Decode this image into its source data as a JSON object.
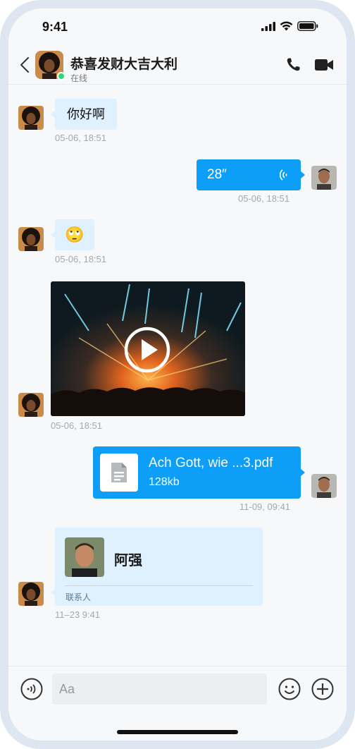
{
  "status_bar": {
    "time": "9:41"
  },
  "header": {
    "title": "恭喜发财大吉大利",
    "status": "在线"
  },
  "messages": [
    {
      "type": "text",
      "direction": "in",
      "text": "你好啊",
      "time": "05-06, 18:51"
    },
    {
      "type": "voice",
      "direction": "out",
      "duration": "28″",
      "time": "05-06, 18:51"
    },
    {
      "type": "emoji",
      "direction": "in",
      "emoji": "🙄",
      "time": "05-06, 18:51"
    },
    {
      "type": "video",
      "direction": "in",
      "time": "05-06, 18:51"
    },
    {
      "type": "file",
      "direction": "out",
      "filename": "Ach Gott, wie ...3.pdf",
      "size": "128kb",
      "time": "11-09, 09:41"
    },
    {
      "type": "contact",
      "direction": "in",
      "name": "阿强",
      "label": "联系人",
      "time": "11–23 9:41"
    }
  ],
  "input": {
    "placeholder": "Aa"
  },
  "colors": {
    "accent": "#0d9ef7",
    "incoming_bubble": "#dff1ff",
    "online": "#2ad87b"
  }
}
